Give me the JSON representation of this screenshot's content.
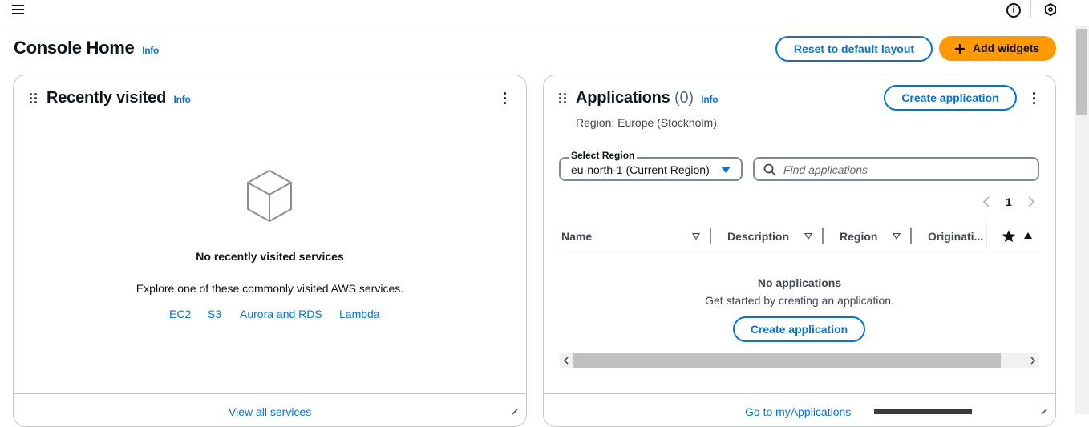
{
  "page": {
    "title": "Console Home",
    "info_label": "Info",
    "reset_button": "Reset to default layout",
    "add_widgets_button": "Add widgets"
  },
  "recently_visited": {
    "title": "Recently visited",
    "info_label": "Info",
    "empty_title": "No recently visited services",
    "explore_text": "Explore one of these commonly visited AWS services.",
    "services": [
      "EC2",
      "S3",
      "Aurora and RDS",
      "Lambda"
    ],
    "footer_link": "View all services"
  },
  "applications": {
    "title": "Applications",
    "count": "(0)",
    "info_label": "Info",
    "create_button": "Create application",
    "region_text": "Region: Europe (Stockholm)",
    "select_region_label": "Select Region",
    "select_region_value": "eu-north-1 (Current Region)",
    "search_placeholder": "Find applications",
    "page_number": "1",
    "columns": [
      "Name",
      "Description",
      "Region",
      "Originati..."
    ],
    "empty_title": "No applications",
    "empty_text": "Get started by creating an application.",
    "empty_create_button": "Create application",
    "footer_link": "Go to myApplications"
  },
  "icons": {
    "menu": "hamburger-icon",
    "info": "info-circle-icon",
    "hex": "hexagon-icon",
    "cube": "cube-icon",
    "search": "search-icon",
    "star": "star-icon",
    "plus": "plus-icon"
  },
  "colors": {
    "accent": "#0972d3",
    "primary_button": "#ff9900",
    "border": "#c6c6cd",
    "text": "#0f141a"
  }
}
